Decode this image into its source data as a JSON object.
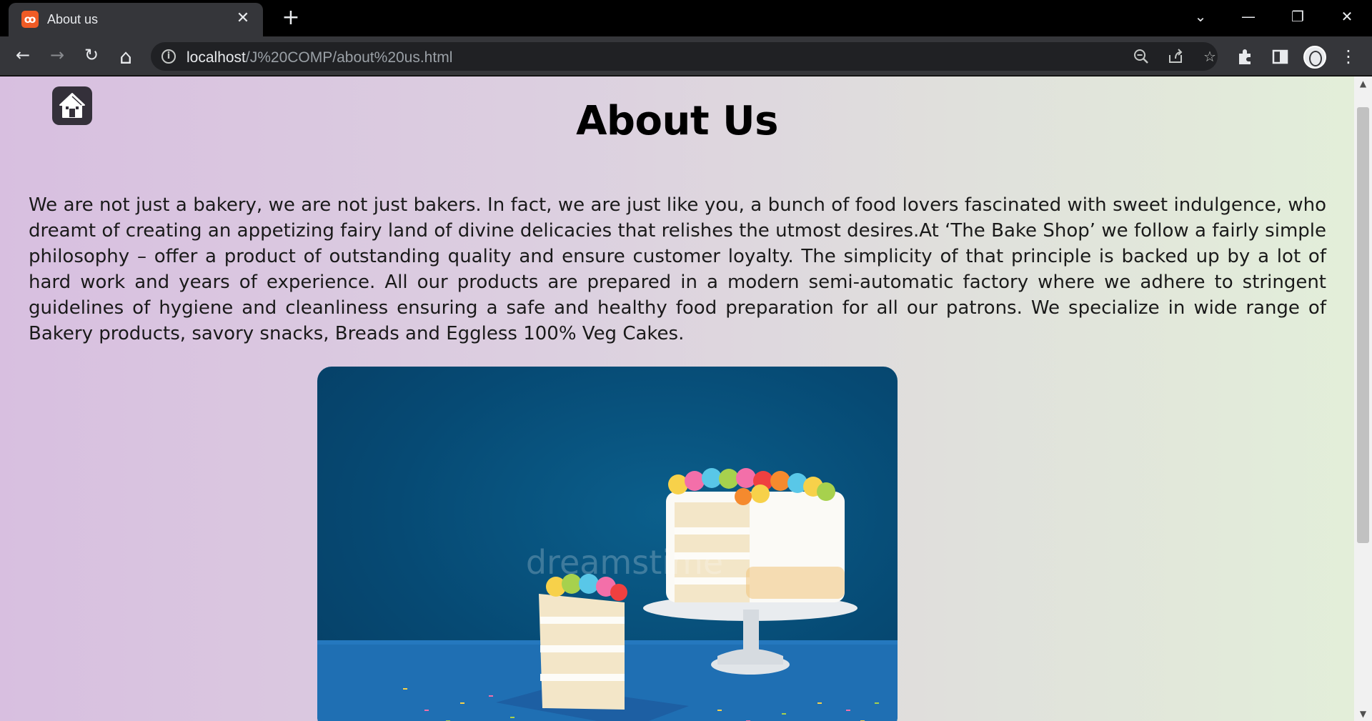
{
  "browser": {
    "tab_title": "About us",
    "tab_close": "✕",
    "new_tab": "+",
    "url_host": "localhost",
    "url_path": "/J%20COMP/about%20us.html",
    "window_controls": {
      "dropdown": "⌄",
      "minimize": "—",
      "restore": "❐",
      "close": "✕"
    },
    "nav": {
      "back": "←",
      "forward": "→",
      "reload": "↻",
      "home": "⌂"
    },
    "icons": [
      "zoom-out-icon",
      "share-icon",
      "bookmark-star-icon",
      "extensions-icon",
      "side-panel-icon",
      "profile-avatar",
      "menu-icon"
    ]
  },
  "page": {
    "title": "About Us",
    "body_text": "We are not just a bakery, we are not just bakers. In fact, we are just like you, a bunch of food lovers fascinated with sweet indulgence, who dreamt of creating an appetizing fairy land of divine delicacies that relishes the utmost desires.At ‘The Bake Shop’ we follow a fairly simple philosophy – offer a product of outstanding quality and ensure customer loyalty. The simplicity of that principle is backed up by a lot of hard work and years of experience. All our products are prepared in a modern semi-automatic factory where we adhere to stringent guidelines of hygiene and cleanliness ensuring a safe and healthy food preparation for all our patrons. We specialize in wide range of Bakery products, savory snacks, Breads and Eggless 100% Veg Cakes.",
    "image_watermark": "dreamstime",
    "colors": {
      "bg_left": "#d8bfe0",
      "bg_right": "#e3efd9",
      "image_bg": "#064a74"
    }
  }
}
